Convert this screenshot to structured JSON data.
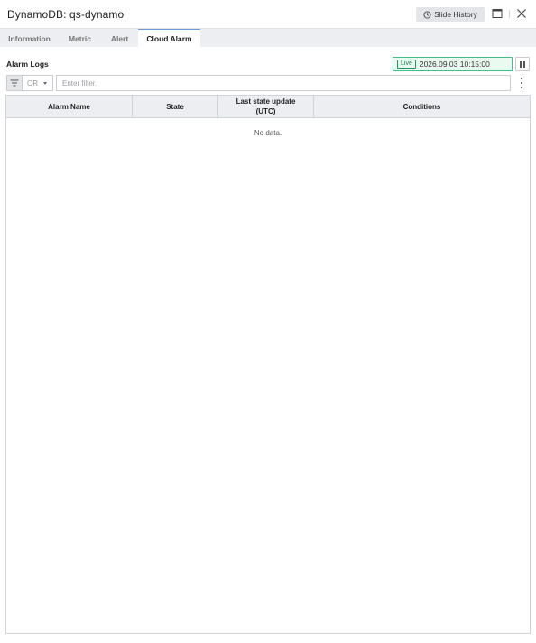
{
  "window": {
    "title": "DynamoDB: qs-dynamo",
    "slide_history_label": "Slide History",
    "icons": {
      "history": "clock-icon",
      "maximize": "maximize-icon",
      "close": "close-icon"
    }
  },
  "tabs": [
    {
      "label": "Information",
      "active": false
    },
    {
      "label": "Metric",
      "active": false
    },
    {
      "label": "Alert",
      "active": false
    },
    {
      "label": "Cloud Alarm",
      "active": true
    }
  ],
  "alarm_logs": {
    "title": "Alarm Logs",
    "live_label": "Live",
    "timestamp": "2026.09.03 10:15:00",
    "pause_icon": "pause-icon"
  },
  "filter": {
    "icon": "filter-icon",
    "operator": "OR",
    "placeholder": "Enter filter.",
    "value": "",
    "more_icon": "kebab-menu-icon"
  },
  "table": {
    "columns": [
      "Alarm Name",
      "State",
      "Last state update (UTC)",
      "Conditions"
    ],
    "rows": [],
    "empty_text": "No data."
  },
  "colors": {
    "live_border": "#42c184",
    "live_background": "#eafaf1",
    "active_tab_accent": "#6a9be0",
    "header_background": "#eceef1"
  }
}
